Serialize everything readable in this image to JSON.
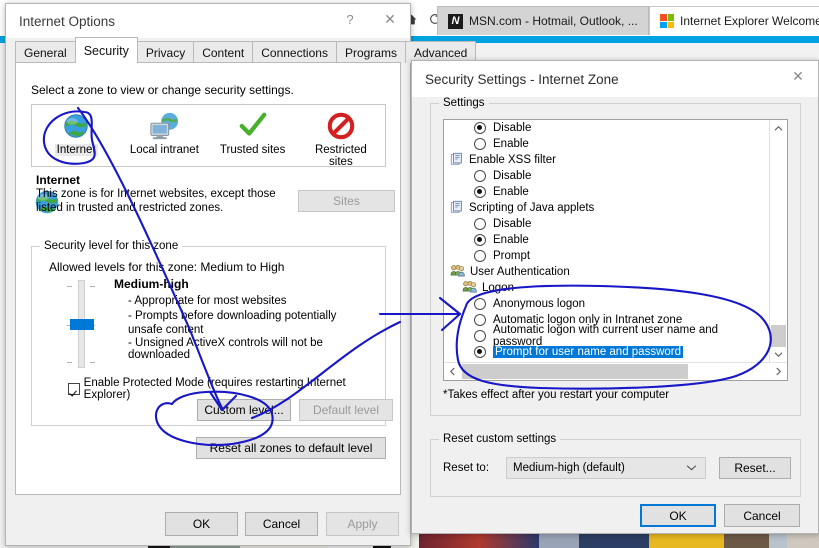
{
  "browser": {
    "nav": {
      "home_icon": "home-icon",
      "refresh_icon": "refresh-icon"
    },
    "tabs": [
      {
        "label": "MSN.com - Hotmail, Outlook, ...",
        "favicon": "msn-favicon",
        "active": false
      },
      {
        "label": "Internet Explorer Welcome",
        "favicon": "microsoft-favicon",
        "active": true
      }
    ],
    "accent_color": "#00a2df"
  },
  "internet_options": {
    "title": "Internet Options",
    "help_label": "?",
    "close_label": "✕",
    "tabs": [
      {
        "label": "General",
        "selected": false
      },
      {
        "label": "Security",
        "selected": true
      },
      {
        "label": "Privacy",
        "selected": false
      },
      {
        "label": "Content",
        "selected": false
      },
      {
        "label": "Connections",
        "selected": false
      },
      {
        "label": "Programs",
        "selected": false
      },
      {
        "label": "Advanced",
        "selected": false
      }
    ],
    "zone_prompt": "Select a zone to view or change security settings.",
    "zones": [
      {
        "label": "Internet",
        "icon": "globe-icon",
        "selected": true
      },
      {
        "label": "Local intranet",
        "icon": "intranet-monitor-icon",
        "selected": false
      },
      {
        "label": "Trusted sites",
        "icon": "green-check-icon",
        "selected": false
      },
      {
        "label": "Restricted sites",
        "icon": "red-prohibited-icon",
        "selected": false
      }
    ],
    "zone_detail": {
      "icon": "globe-icon",
      "name": "Internet",
      "description": "This zone is for Internet websites, except those listed in trusted and restricted zones.",
      "sites_button": "Sites",
      "sites_button_disabled": true
    },
    "security_level": {
      "caption": "Security level for this zone",
      "allowed_levels": "Allowed levels for this zone: Medium to High",
      "level_name": "Medium-high",
      "bullets": [
        "- Appropriate for most websites",
        "- Prompts before downloading potentially unsafe content",
        "- Unsigned ActiveX controls will not be downloaded"
      ],
      "protected_mode_label": "Enable Protected Mode (requires restarting Internet Explorer)",
      "protected_mode_checked": true,
      "custom_level_button": "Custom level...",
      "default_level_button": "Default level",
      "default_level_disabled": true
    },
    "reset_all_button": "Reset all zones to default level",
    "footer": {
      "ok": "OK",
      "cancel": "Cancel",
      "apply": "Apply",
      "apply_disabled": true
    }
  },
  "security_settings": {
    "title": "Security Settings - Internet Zone",
    "close_label": "✕",
    "settings_caption": "Settings",
    "rows": [
      {
        "kind": "option",
        "label": "Disable",
        "checked": true
      },
      {
        "kind": "option",
        "label": "Enable",
        "checked": false
      },
      {
        "kind": "group",
        "label": "Enable XSS filter",
        "icon": "script-page-icon"
      },
      {
        "kind": "option",
        "label": "Disable",
        "checked": false
      },
      {
        "kind": "option",
        "label": "Enable",
        "checked": true
      },
      {
        "kind": "group",
        "label": "Scripting of Java applets",
        "icon": "script-page-icon"
      },
      {
        "kind": "option",
        "label": "Disable",
        "checked": false
      },
      {
        "kind": "option",
        "label": "Enable",
        "checked": true
      },
      {
        "kind": "option",
        "label": "Prompt",
        "checked": false
      },
      {
        "kind": "group",
        "label": "User Authentication",
        "icon": "users-icon"
      },
      {
        "kind": "group2",
        "label": "Logon",
        "icon": "users-icon"
      },
      {
        "kind": "option",
        "label": "Anonymous logon",
        "checked": false
      },
      {
        "kind": "option",
        "label": "Automatic logon only in Intranet zone",
        "checked": false
      },
      {
        "kind": "option",
        "label": "Automatic logon with current user name and password",
        "checked": false
      },
      {
        "kind": "option",
        "label": "Prompt for user name and password",
        "checked": true,
        "highlighted": true
      }
    ],
    "restart_note": "*Takes effect after you restart your computer",
    "reset_caption": "Reset custom settings",
    "reset_to_label": "Reset to:",
    "reset_to_value": "Medium-high (default)",
    "reset_button": "Reset...",
    "footer": {
      "ok": "OK",
      "cancel": "Cancel"
    },
    "selection_color": "#0078d7"
  },
  "annotations": {
    "ink_color": "#1717c8",
    "marks": [
      "circle-around-internet-zone",
      "arrow-from-internet-zone-to-custom-level",
      "circle-around-custom-level-button",
      "arrow-to-logon-section",
      "circle-around-logon-options"
    ]
  }
}
